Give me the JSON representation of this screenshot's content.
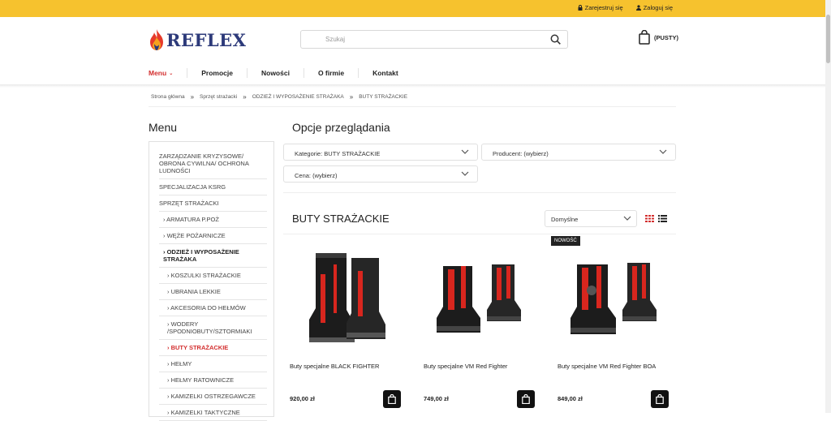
{
  "topbar": {
    "register": "Zarejestruj się",
    "login": "Zaloguj się"
  },
  "logo": {
    "text": "REFLEX"
  },
  "search": {
    "placeholder": "Szukaj"
  },
  "cart": {
    "label": "(PUSTY)"
  },
  "nav": [
    "Menu",
    "Promocje",
    "Nowości",
    "O firmie",
    "Kontakt"
  ],
  "breadcrumb": [
    "Strona główna",
    "Sprzęt strażacki",
    "ODZIEŻ I WYPOSAŻENIE STRAŻAKA",
    "BUTY STRAŻACKIE"
  ],
  "sidebar": {
    "title": "Menu",
    "items": [
      "ZARZĄDZANIE KRYZYSOWE/ OBRONA CYWILNA/ OCHRONA LUDNOŚCI",
      "SPECJALIZACJA KSRG",
      "SPRZĘT STRAŻACKI",
      "› ARMATURA P.POŻ",
      "› WĘŻE POŻARNICZE",
      "› ODZIEŻ I WYPOSAŻENIE STRAŻAKA",
      "› KOSZULKI STRAŻACKIE",
      "› UBRANIA LEKKIE",
      "› AKCESORIA DO HEŁMÓW",
      "› WODERY /SPODNIOBUTY/SZTORMIAKI",
      "› BUTY STRAŻACKIE",
      "› HEŁMY",
      "› HEŁMY RATOWNICZE",
      "› KAMIZELKI OSTRZEGAWCZE",
      "› KAMIZELKI TAKTYCZNE"
    ]
  },
  "options": {
    "title": "Opcje przeglądania",
    "category": "Kategorie: BUTY STRAŻACKIE",
    "producer": "Producent: (wybierz)",
    "price": "Cena: (wybierz)"
  },
  "listing": {
    "title": "BUTY STRAŻACKIE",
    "sort": "Domyślne",
    "badge": "NOWOŚĆ",
    "products": [
      {
        "name": "Buty specjalne BLACK FIGHTER",
        "price": "920,00 zł"
      },
      {
        "name": "Buty specjalne VM Red Fighter",
        "price": "749,00 zł"
      },
      {
        "name": "Buty specjalne VM Red Fighter BOA",
        "price": "849,00 zł"
      }
    ]
  },
  "colors": {
    "accent": "#f6c22e",
    "red": "#d32f2f",
    "navy": "#2d3a7a"
  }
}
